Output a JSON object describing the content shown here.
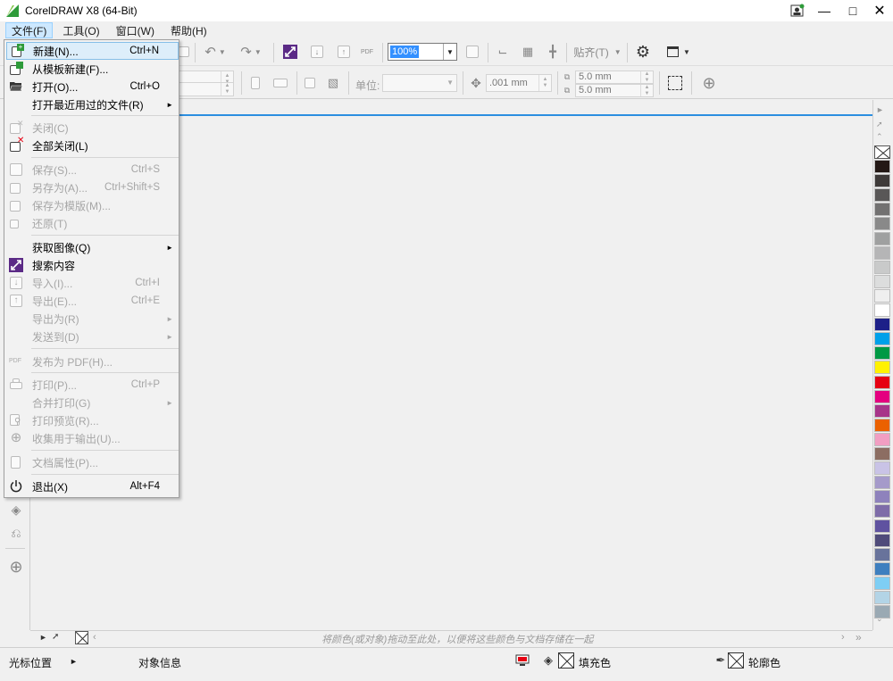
{
  "window": {
    "title": "CorelDRAW X8 (64-Bit)"
  },
  "menubar": [
    {
      "label": "文件(F)",
      "active": true
    },
    {
      "label": "工具(O)",
      "active": false
    },
    {
      "label": "窗口(W)",
      "active": false
    },
    {
      "label": "帮助(H)",
      "active": false
    }
  ],
  "toolbar": {
    "zoom_value": "100%",
    "snap_label": "贴齐(T)",
    "units_label": "单位:",
    "nudge_value": ".001 mm",
    "dup_x": "5.0 mm",
    "dup_y": "5.0 mm"
  },
  "file_menu": {
    "items": [
      {
        "label": "新建(N)...",
        "shortcut": "Ctrl+N",
        "enabled": true,
        "highlighted": true
      },
      {
        "label": "从模板新建(F)...",
        "shortcut": "",
        "enabled": true
      },
      {
        "label": "打开(O)...",
        "shortcut": "Ctrl+O",
        "enabled": true
      },
      {
        "label": "打开最近用过的文件(R)",
        "shortcut": "",
        "enabled": true,
        "submenu": true
      },
      {
        "label": "关闭(C)",
        "shortcut": "",
        "enabled": false
      },
      {
        "label": "全部关闭(L)",
        "shortcut": "",
        "enabled": true
      },
      {
        "label": "保存(S)...",
        "shortcut": "Ctrl+S",
        "enabled": false
      },
      {
        "label": "另存为(A)...",
        "shortcut": "Ctrl+Shift+S",
        "enabled": false
      },
      {
        "label": "保存为模版(M)...",
        "shortcut": "",
        "enabled": false
      },
      {
        "label": "还原(T)",
        "shortcut": "",
        "enabled": false
      },
      {
        "label": "获取图像(Q)",
        "shortcut": "",
        "enabled": true,
        "submenu": true
      },
      {
        "label": "搜索内容",
        "shortcut": "",
        "enabled": true
      },
      {
        "label": "导入(I)...",
        "shortcut": "Ctrl+I",
        "enabled": false
      },
      {
        "label": "导出(E)...",
        "shortcut": "Ctrl+E",
        "enabled": false
      },
      {
        "label": "导出为(R)",
        "shortcut": "",
        "enabled": false,
        "submenu": true
      },
      {
        "label": "发送到(D)",
        "shortcut": "",
        "enabled": false,
        "submenu": true
      },
      {
        "label": "发布为 PDF(H)...",
        "shortcut": "",
        "enabled": false
      },
      {
        "label": "打印(P)...",
        "shortcut": "Ctrl+P",
        "enabled": false
      },
      {
        "label": "合并打印(G)",
        "shortcut": "",
        "enabled": false,
        "submenu": true
      },
      {
        "label": "打印预览(R)...",
        "shortcut": "",
        "enabled": false
      },
      {
        "label": "收集用于输出(U)...",
        "shortcut": "",
        "enabled": false
      },
      {
        "label": "文档属性(P)...",
        "shortcut": "",
        "enabled": false
      },
      {
        "label": "退出(X)",
        "shortcut": "Alt+F4",
        "enabled": true
      }
    ]
  },
  "palette_colors": [
    "#231815",
    "#3e3a39",
    "#595757",
    "#727171",
    "#898989",
    "#9fa0a0",
    "#b5b5b6",
    "#c9caca",
    "#dcdddd",
    "#efefef",
    "#ffffff",
    "#1d2088",
    "#00a0e9",
    "#009944",
    "#fff100",
    "#e60012",
    "#e4007f",
    "#a73489",
    "#eb6100",
    "#f19ec2",
    "#8c6d62",
    "#c9c3e6",
    "#a59aca",
    "#8e82bc",
    "#7e6ca8",
    "#5f52a0",
    "#4f4b7a",
    "#68739b",
    "#3e7fbf",
    "#7ecef4",
    "#b3d4e6",
    "#9aa9b3"
  ],
  "doc_palette": {
    "hint": "将颜色(或对象)拖动至此处，以便将这些颜色与文档存储在一起"
  },
  "status": {
    "cursor_pos": "光标位置",
    "object_info": "对象信息",
    "fill_label": "填充色",
    "outline_label": "轮廓色"
  },
  "colors": {
    "accent": "#2b8ee0",
    "menu_highlight": "#ddeefa",
    "selection": "#3390ff"
  }
}
